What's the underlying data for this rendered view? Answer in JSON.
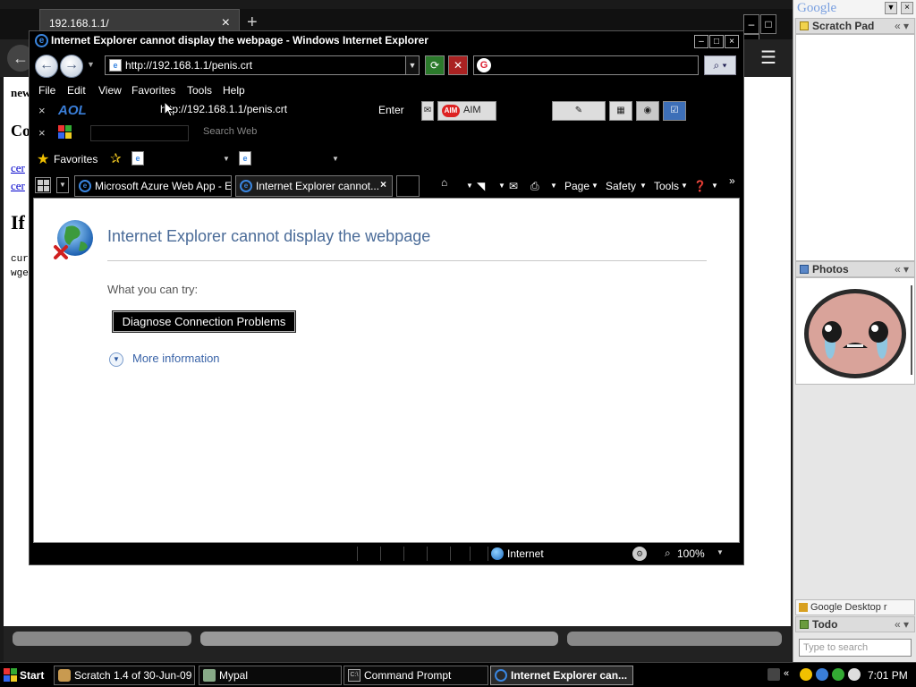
{
  "bg_browser": {
    "tab_title": "192.168.1.1/",
    "content": {
      "line1": "new",
      "heading1": "Co",
      "link1": "cer",
      "link2": "cer",
      "heading2": "If",
      "code1": "cur",
      "code2": "wge"
    }
  },
  "ie": {
    "window_title": "Internet Explorer cannot display the webpage - Windows Internet Explorer",
    "address": "http://192.168.1.1/penis.crt",
    "menu": [
      "File",
      "Edit",
      "View",
      "Favorites",
      "Tools",
      "Help"
    ],
    "aol_toolbar": {
      "logo": "AOL",
      "url": "http://192.168.1.1/penis.crt",
      "enter_label": "Enter",
      "aim_label": "AIM"
    },
    "toolbar3": {
      "search_label": "Search Web"
    },
    "favorites_label": "Favorites",
    "tabs": [
      {
        "label": "Microsoft Azure Web App - E..."
      },
      {
        "label": "Internet Explorer cannot..."
      }
    ],
    "command_bar": {
      "page": "Page",
      "safety": "Safety",
      "tools": "Tools"
    },
    "error_page": {
      "title": "Internet Explorer cannot display the webpage",
      "what_you_can_try": "What you can try:",
      "diagnose_button": "Diagnose Connection Problems",
      "more_information": "More information"
    },
    "status_bar": {
      "zone": "Internet",
      "zoom": "100%"
    }
  },
  "sidebar": {
    "logo": "Google",
    "gadgets": {
      "scratch_pad": "Scratch Pad",
      "photos": "Photos",
      "google_desktop": "Google Desktop r",
      "todo": "Todo"
    },
    "search_placeholder": "Type to search"
  },
  "taskbar": {
    "start": "Start",
    "tasks": [
      {
        "label": "Scratch 1.4 of 30-Jun-09"
      },
      {
        "label": "Mypal"
      },
      {
        "label": "Command Prompt"
      },
      {
        "label": "Internet Explorer can..."
      }
    ],
    "clock": "7:01 PM"
  },
  "colors": {
    "error_title": "#4a6b98",
    "link": "#3a64a8",
    "chrome_black": "#000000"
  }
}
